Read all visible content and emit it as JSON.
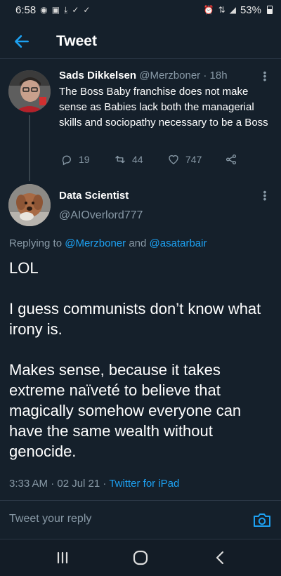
{
  "status_bar": {
    "time": "6:58",
    "battery": "53%",
    "left_icons": [
      "whatsapp-icon",
      "screenshot-icon",
      "download-icon",
      "check-icon",
      "check-icon"
    ],
    "right_icons": [
      "alarm-icon",
      "vowifi-icon",
      "signal-icon",
      "battery-icon"
    ]
  },
  "header": {
    "title": "Tweet"
  },
  "parent_tweet": {
    "name": "Sads Dikkelsen",
    "handle": "@Merzboner",
    "time": "· 18h",
    "text": "The Boss Baby franchise does not make sense as Babies lack both the managerial skills and sociopathy necessary to be a Boss",
    "replies": "19",
    "retweets": "44",
    "likes": "747"
  },
  "main_tweet": {
    "name": "Data Scientist",
    "handle": "@AIOverlord777",
    "replying_to_prefix": "Replying to",
    "reply_handle_1": "@Merzboner",
    "reply_and": "and",
    "reply_handle_2": "@asatarbair",
    "paragraph_1": "LOL",
    "paragraph_2": "I guess communists don’t know what irony is.",
    "paragraph_3": "Makes sense, because it takes extreme naïveté to believe that magically somehow everyone can have the same wealth without genocide.",
    "timestamp": "3:33 AM · 02 Jul 21 ·",
    "source": "Twitter for iPad"
  },
  "reply_bar": {
    "placeholder": "Tweet your reply"
  },
  "colors": {
    "background": "#15202b",
    "accent": "#1da1f2",
    "muted": "#8899a6"
  }
}
